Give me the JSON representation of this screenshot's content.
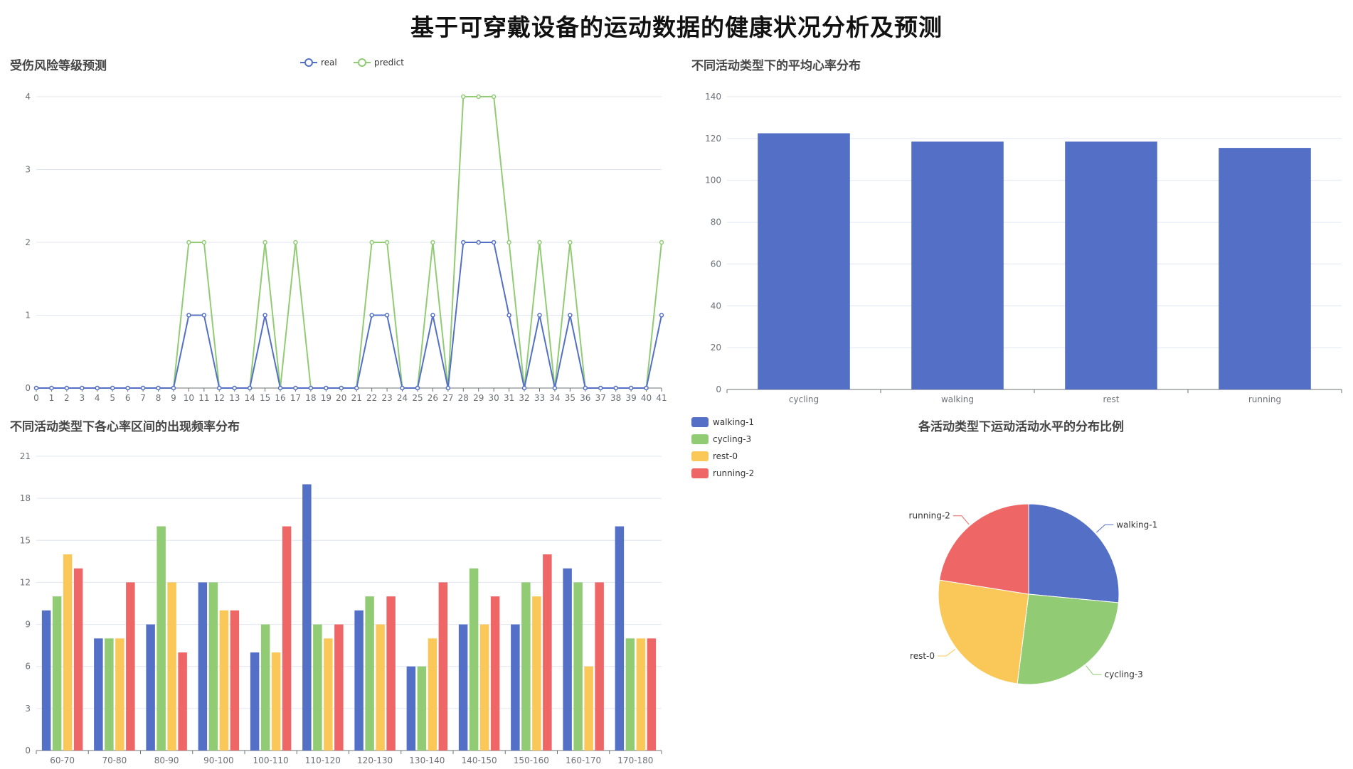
{
  "page": {
    "title": "基于可穿戴设备的运动数据的健康状况分析及预测"
  },
  "colors": {
    "blue": "#5470c6",
    "green": "#91cc75",
    "yellow": "#fac858",
    "red": "#ee6666",
    "axis": "#6e7079",
    "grid": "#e0e6f1"
  },
  "chart_data": [
    {
      "id": "injury-risk",
      "type": "line",
      "title": "受伤风险等级预测",
      "categories": [
        "0",
        "1",
        "2",
        "3",
        "4",
        "5",
        "6",
        "7",
        "8",
        "9",
        "10",
        "11",
        "12",
        "13",
        "14",
        "15",
        "16",
        "17",
        "18",
        "19",
        "20",
        "21",
        "22",
        "23",
        "24",
        "25",
        "26",
        "27",
        "28",
        "29",
        "30",
        "31",
        "32",
        "33",
        "34",
        "35",
        "36",
        "37",
        "38",
        "39",
        "40",
        "41"
      ],
      "series": [
        {
          "name": "real",
          "color": "#5470c6",
          "values": [
            0,
            0,
            0,
            0,
            0,
            0,
            0,
            0,
            0,
            0,
            1,
            1,
            0,
            0,
            0,
            1,
            0,
            0,
            0,
            0,
            0,
            0,
            1,
            1,
            0,
            0,
            1,
            0,
            2,
            2,
            2,
            1,
            0,
            1,
            0,
            1,
            0,
            0,
            0,
            0,
            0,
            1
          ]
        },
        {
          "name": "predict",
          "color": "#91cc75",
          "values": [
            0,
            0,
            0,
            0,
            0,
            0,
            0,
            0,
            0,
            0,
            2,
            2,
            0,
            0,
            0,
            2,
            0,
            2,
            0,
            0,
            0,
            0,
            2,
            2,
            0,
            0,
            2,
            0,
            4,
            4,
            4,
            2,
            0,
            2,
            0,
            2,
            0,
            0,
            0,
            0,
            0,
            2
          ]
        }
      ],
      "ylim": [
        0,
        4
      ],
      "yticks": [
        0,
        1,
        2,
        3,
        4
      ],
      "grid": true,
      "legend": "top-center"
    },
    {
      "id": "avg-heart-rate",
      "type": "bar",
      "title": "不同活动类型下的平均心率分布",
      "categories": [
        "cycling",
        "walking",
        "rest",
        "running"
      ],
      "values": [
        122.5,
        118.5,
        118.5,
        115.5
      ],
      "color": "#5470c6",
      "ylim": [
        0,
        140
      ],
      "yticks": [
        0,
        20,
        40,
        60,
        80,
        100,
        120,
        140
      ],
      "grid": true
    },
    {
      "id": "hr-interval-frequency",
      "type": "bar",
      "title": "不同活动类型下各心率区间的出现频率分布",
      "categories": [
        "60-70",
        "70-80",
        "80-90",
        "90-100",
        "100-110",
        "110-120",
        "120-130",
        "130-140",
        "140-150",
        "150-160",
        "160-170",
        "170-180"
      ],
      "series": [
        {
          "color": "#5470c6",
          "values": [
            10,
            8,
            9,
            12,
            7,
            19,
            10,
            6,
            9,
            9,
            13,
            16
          ]
        },
        {
          "color": "#91cc75",
          "values": [
            11,
            8,
            16,
            12,
            9,
            9,
            11,
            6,
            13,
            12,
            12,
            8
          ]
        },
        {
          "color": "#fac858",
          "values": [
            14,
            8,
            12,
            10,
            7,
            8,
            9,
            8,
            9,
            11,
            6,
            8
          ]
        },
        {
          "color": "#ee6666",
          "values": [
            13,
            12,
            7,
            10,
            16,
            9,
            11,
            12,
            11,
            14,
            12,
            8
          ]
        }
      ],
      "ylim": [
        0,
        21
      ],
      "yticks": [
        0,
        3,
        6,
        9,
        12,
        15,
        18,
        21
      ],
      "grid": true
    },
    {
      "id": "activity-level-ratio",
      "type": "pie",
      "title": "各活动类型下运动活动水平的分布比例",
      "slices": [
        {
          "name": "walking-1",
          "value": 26.5,
          "color": "#5470c6"
        },
        {
          "name": "cycling-3",
          "value": 25.5,
          "color": "#91cc75"
        },
        {
          "name": "rest-0",
          "value": 25.5,
          "color": "#fac858"
        },
        {
          "name": "running-2",
          "value": 22.5,
          "color": "#ee6666"
        }
      ],
      "legend": "top-left"
    }
  ]
}
